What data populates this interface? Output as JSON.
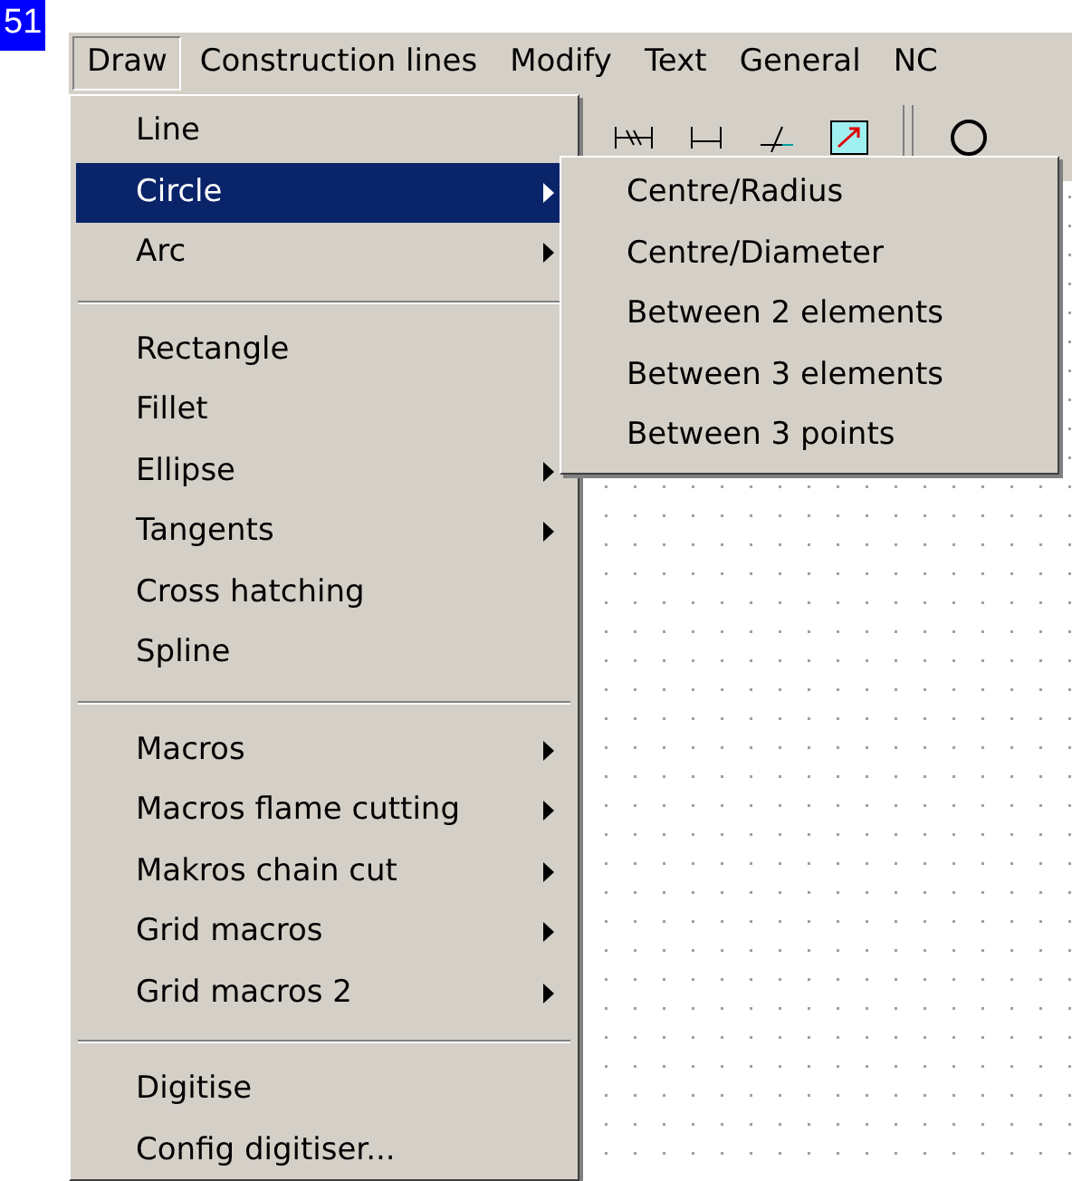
{
  "badge": "51",
  "menubar": [
    {
      "label": "Draw",
      "selected": true
    },
    {
      "label": "Construction lines",
      "selected": false
    },
    {
      "label": "Modify",
      "selected": false
    },
    {
      "label": "Text",
      "selected": false
    },
    {
      "label": "General",
      "selected": false
    },
    {
      "label": "NC",
      "selected": false
    }
  ],
  "menu": [
    {
      "kind": "item",
      "label": "Line",
      "submenu": false,
      "selected": false
    },
    {
      "kind": "item",
      "label": "Circle",
      "submenu": true,
      "selected": true
    },
    {
      "kind": "item",
      "label": "Arc",
      "submenu": true,
      "selected": false
    },
    {
      "kind": "separator"
    },
    {
      "kind": "item",
      "label": "Rectangle",
      "submenu": false,
      "selected": false
    },
    {
      "kind": "item",
      "label": "Fillet",
      "submenu": false,
      "selected": false
    },
    {
      "kind": "item",
      "label": "Ellipse",
      "submenu": true,
      "selected": false
    },
    {
      "kind": "item",
      "label": "Tangents",
      "submenu": true,
      "selected": false
    },
    {
      "kind": "item",
      "label": "Cross hatching",
      "submenu": false,
      "selected": false
    },
    {
      "kind": "item",
      "label": "Spline",
      "submenu": false,
      "selected": false
    },
    {
      "kind": "separator"
    },
    {
      "kind": "item",
      "label": "Macros",
      "submenu": true,
      "selected": false
    },
    {
      "kind": "item",
      "label": "Macros flame cutting",
      "submenu": true,
      "selected": false
    },
    {
      "kind": "item",
      "label": "Makros chain cut",
      "submenu": true,
      "selected": false
    },
    {
      "kind": "item",
      "label": "Grid macros",
      "submenu": true,
      "selected": false
    },
    {
      "kind": "item",
      "label": "Grid macros 2",
      "submenu": true,
      "selected": false
    },
    {
      "kind": "separator"
    },
    {
      "kind": "item",
      "label": "Digitise",
      "submenu": false,
      "selected": false
    },
    {
      "kind": "item",
      "label": "Config digitiser...",
      "submenu": false,
      "selected": false
    }
  ],
  "submenu": [
    {
      "label": "Centre/Radius"
    },
    {
      "label": "Centre/Diameter"
    },
    {
      "label": "Between 2 elements"
    },
    {
      "label": "Between 3 elements"
    },
    {
      "label": "Between 3 points"
    }
  ]
}
